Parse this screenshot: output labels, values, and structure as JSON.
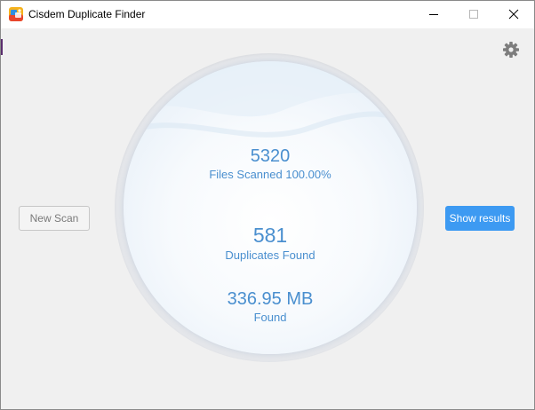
{
  "window": {
    "title": "Cisdem Duplicate Finder",
    "app_icon": "cisdem-app-icon",
    "controls": [
      "minimize-icon",
      "maximize-icon",
      "close-icon"
    ]
  },
  "toolbar": {
    "settings_icon": "gear-icon"
  },
  "stats": {
    "files_scanned_value": "5320",
    "files_scanned_label": "Files Scanned 100.00%",
    "duplicates_value": "581",
    "duplicates_label": "Duplicates Found",
    "size_value": "336.95 MB",
    "size_label": "Found"
  },
  "actions": {
    "new_scan_label": "New Scan",
    "show_results_label": "Show results"
  },
  "colors": {
    "accent": "#3d9af2",
    "stat_text": "#4a8fcf",
    "background": "#f0f0f0"
  }
}
